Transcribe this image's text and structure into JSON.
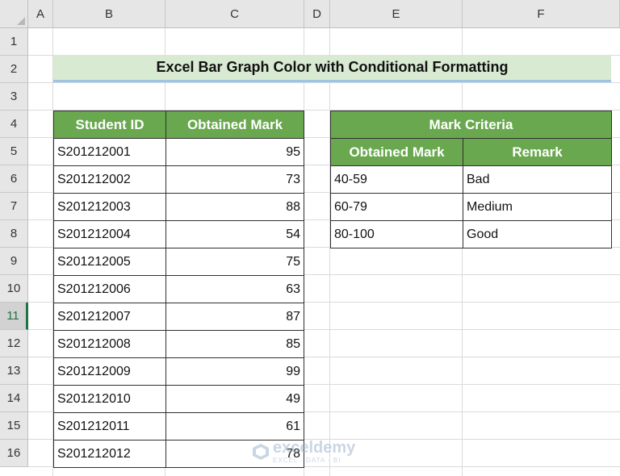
{
  "columns": [
    "A",
    "B",
    "C",
    "D",
    "E",
    "F"
  ],
  "rows": [
    "1",
    "2",
    "3",
    "4",
    "5",
    "6",
    "7",
    "8",
    "9",
    "10",
    "11",
    "12",
    "13",
    "14",
    "15",
    "16"
  ],
  "active_row": "11",
  "title": "Excel Bar Graph Color with Conditional Formatting",
  "students_table": {
    "headers": [
      "Student ID",
      "Obtained Mark"
    ],
    "rows": [
      {
        "id": "S201212001",
        "mark": "95"
      },
      {
        "id": "S201212002",
        "mark": "73"
      },
      {
        "id": "S201212003",
        "mark": "88"
      },
      {
        "id": "S201212004",
        "mark": "54"
      },
      {
        "id": "S201212005",
        "mark": "75"
      },
      {
        "id": "S201212006",
        "mark": "63"
      },
      {
        "id": "S201212007",
        "mark": "87"
      },
      {
        "id": "S201212008",
        "mark": "85"
      },
      {
        "id": "S201212009",
        "mark": "99"
      },
      {
        "id": "S201212010",
        "mark": "49"
      },
      {
        "id": "S201212011",
        "mark": "61"
      },
      {
        "id": "S201212012",
        "mark": "78"
      }
    ]
  },
  "criteria_table": {
    "title": "Mark Criteria",
    "headers": [
      "Obtained Mark",
      "Remark"
    ],
    "rows": [
      {
        "range": "40-59",
        "remark": "Bad"
      },
      {
        "range": "60-79",
        "remark": "Medium"
      },
      {
        "range": "80-100",
        "remark": "Good"
      }
    ]
  },
  "watermark": {
    "name": "exceldemy",
    "tagline": "EXCEL · DATA · BI"
  },
  "colors": {
    "header_green": "#6aa84f",
    "title_bg": "#d9ead3",
    "title_underline": "#9dc3e6",
    "active_row": "#217346"
  }
}
